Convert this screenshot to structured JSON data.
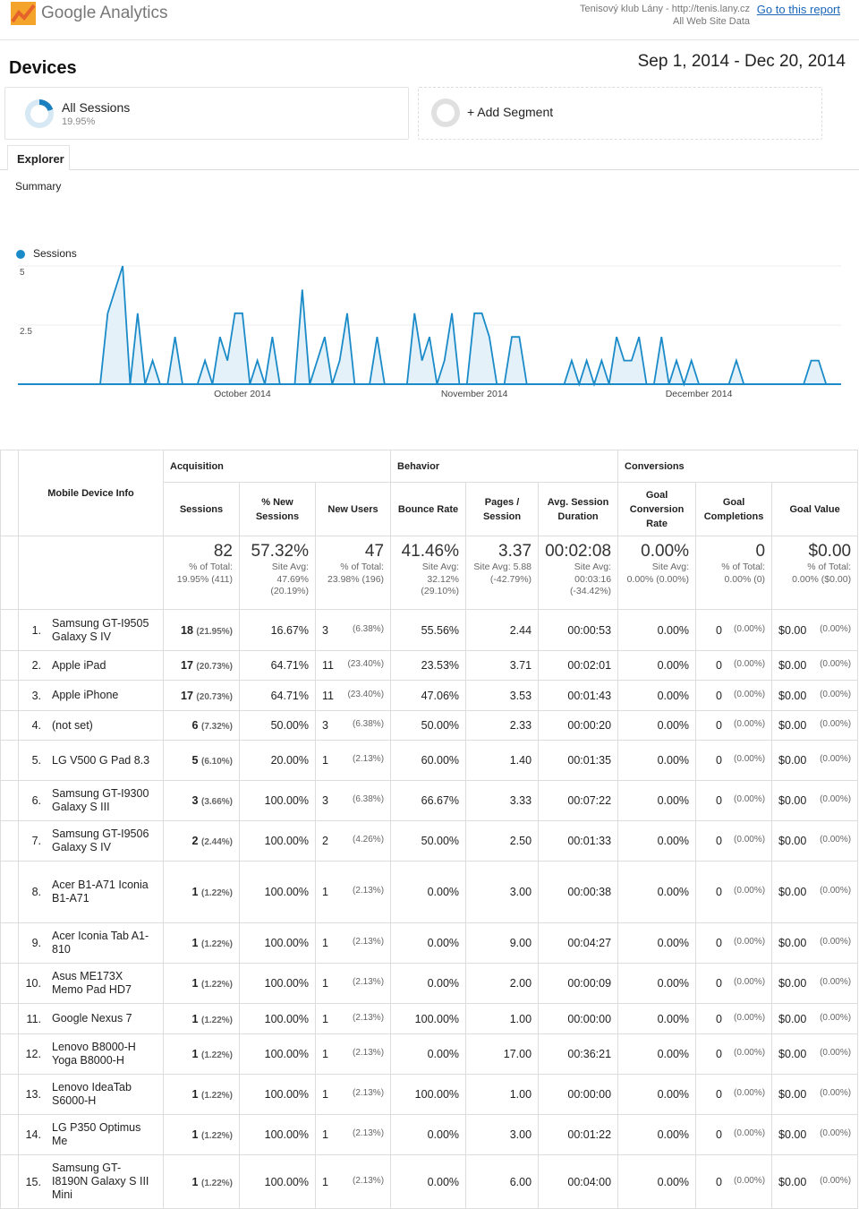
{
  "header": {
    "logo_text": "Google Analytics",
    "property": "Tenisový klub Lány - http://tenis.lany.cz",
    "view": "All Web Site Data",
    "go_to_report": "Go to this report"
  },
  "page": {
    "title": "Devices",
    "date_range": "Sep 1, 2014 - Dec 20, 2014"
  },
  "segments": [
    {
      "label": "All Sessions",
      "percent": "19.95%",
      "fill_fraction": 0.1995
    },
    {
      "label": "+ Add Segment"
    }
  ],
  "tabs": {
    "explorer": "Explorer",
    "summary": "Summary"
  },
  "colors": {
    "series": "#1a8bc8",
    "link": "#1a66b8"
  },
  "chart_data": {
    "type": "area",
    "interval": "day",
    "series": [
      {
        "name": "Sessions",
        "values": [
          0,
          0,
          0,
          0,
          0,
          0,
          0,
          0,
          0,
          0,
          0,
          0,
          3,
          4,
          5,
          0,
          3,
          0,
          1,
          0,
          0,
          2,
          0,
          0,
          0,
          1,
          0,
          2,
          1,
          3,
          3,
          0,
          1,
          0,
          2,
          0,
          0,
          0,
          4,
          0,
          1,
          2,
          0,
          1,
          3,
          0,
          0,
          0,
          2,
          0,
          0,
          0,
          0,
          3,
          1,
          2,
          0,
          1,
          3,
          0,
          0,
          3,
          3,
          2,
          0,
          0,
          2,
          2,
          0,
          0,
          0,
          0,
          0,
          0,
          1,
          0,
          1,
          0,
          1,
          0,
          2,
          1,
          1,
          2,
          0,
          0,
          2,
          0,
          1,
          0,
          1,
          0,
          0,
          0,
          0,
          0,
          1,
          0,
          0,
          0,
          0,
          0,
          0,
          0,
          0,
          0,
          1,
          1,
          0,
          0,
          0
        ]
      }
    ],
    "x_ticks": [
      "October 2014",
      "November 2014",
      "December 2014"
    ],
    "y_ticks": [
      "2.5",
      "5"
    ],
    "ylim": [
      0,
      5
    ],
    "grid": true,
    "legend": "top-left"
  },
  "table": {
    "groups": {
      "dimension": "Mobile Device Info",
      "acquisition": "Acquisition",
      "behavior": "Behavior",
      "conversions": "Conversions"
    },
    "columns": [
      "Sessions",
      "% New Sessions",
      "New Users",
      "Bounce Rate",
      "Pages / Session",
      "Avg. Session Duration",
      "Goal Conversion Rate",
      "Goal Completions",
      "Goal Value"
    ],
    "totals": [
      {
        "value": "82",
        "sub": "% of Total: 19.95% (411)"
      },
      {
        "value": "57.32%",
        "sub": "Site Avg: 47.69% (20.19%)"
      },
      {
        "value": "47",
        "sub": "% of Total: 23.98% (196)"
      },
      {
        "value": "41.46%",
        "sub": "Site Avg: 32.12% (29.10%)"
      },
      {
        "value": "3.37",
        "sub": "Site Avg: 5.88 (-42.79%)"
      },
      {
        "value": "00:02:08",
        "sub": "Site Avg: 00:03:16 (-34.42%)"
      },
      {
        "value": "0.00%",
        "sub": "Site Avg: 0.00% (0.00%)"
      },
      {
        "value": "0",
        "sub": "% of Total: 0.00% (0)"
      },
      {
        "value": "$0.00",
        "sub": "% of Total: 0.00% ($0.00)"
      }
    ],
    "rows": [
      [
        "1.",
        "Samsung GT-I9505 Galaxy S IV",
        "18",
        "(21.95%)",
        "16.67%",
        "3",
        "(6.38%)",
        "55.56%",
        "2.44",
        "00:00:53",
        "0.00%",
        "0",
        "(0.00%)",
        "$0.00",
        "(0.00%)"
      ],
      [
        "2.",
        "Apple iPad",
        "17",
        "(20.73%)",
        "64.71%",
        "11",
        "(23.40%)",
        "23.53%",
        "3.71",
        "00:02:01",
        "0.00%",
        "0",
        "(0.00%)",
        "$0.00",
        "(0.00%)"
      ],
      [
        "3.",
        "Apple iPhone",
        "17",
        "(20.73%)",
        "64.71%",
        "11",
        "(23.40%)",
        "47.06%",
        "3.53",
        "00:01:43",
        "0.00%",
        "0",
        "(0.00%)",
        "$0.00",
        "(0.00%)"
      ],
      [
        "4.",
        "(not set)",
        "6",
        "(7.32%)",
        "50.00%",
        "3",
        "(6.38%)",
        "50.00%",
        "2.33",
        "00:00:20",
        "0.00%",
        "0",
        "(0.00%)",
        "$0.00",
        "(0.00%)"
      ],
      [
        "5.",
        "LG V500 G Pad 8.3",
        "5",
        "(6.10%)",
        "20.00%",
        "1",
        "(2.13%)",
        "60.00%",
        "1.40",
        "00:01:35",
        "0.00%",
        "0",
        "(0.00%)",
        "$0.00",
        "(0.00%)"
      ],
      [
        "6.",
        "Samsung GT-I9300 Galaxy S III",
        "3",
        "(3.66%)",
        "100.00%",
        "3",
        "(6.38%)",
        "66.67%",
        "3.33",
        "00:07:22",
        "0.00%",
        "0",
        "(0.00%)",
        "$0.00",
        "(0.00%)"
      ],
      [
        "7.",
        "Samsung GT-I9506 Galaxy S IV",
        "2",
        "(2.44%)",
        "100.00%",
        "2",
        "(4.26%)",
        "50.00%",
        "2.50",
        "00:01:33",
        "0.00%",
        "0",
        "(0.00%)",
        "$0.00",
        "(0.00%)"
      ],
      [
        "8.",
        "Acer B1-A71 Iconia B1-A71",
        "1",
        "(1.22%)",
        "100.00%",
        "1",
        "(2.13%)",
        "0.00%",
        "3.00",
        "00:00:38",
        "0.00%",
        "0",
        "(0.00%)",
        "$0.00",
        "(0.00%)"
      ],
      [
        "9.",
        "Acer Iconia Tab A1-810",
        "1",
        "(1.22%)",
        "100.00%",
        "1",
        "(2.13%)",
        "0.00%",
        "9.00",
        "00:04:27",
        "0.00%",
        "0",
        "(0.00%)",
        "$0.00",
        "(0.00%)"
      ],
      [
        "10.",
        "Asus ME173X Memo Pad HD7",
        "1",
        "(1.22%)",
        "100.00%",
        "1",
        "(2.13%)",
        "0.00%",
        "2.00",
        "00:00:09",
        "0.00%",
        "0",
        "(0.00%)",
        "$0.00",
        "(0.00%)"
      ],
      [
        "11.",
        "Google Nexus 7",
        "1",
        "(1.22%)",
        "100.00%",
        "1",
        "(2.13%)",
        "100.00%",
        "1.00",
        "00:00:00",
        "0.00%",
        "0",
        "(0.00%)",
        "$0.00",
        "(0.00%)"
      ],
      [
        "12.",
        "Lenovo B8000-H Yoga B8000-H",
        "1",
        "(1.22%)",
        "100.00%",
        "1",
        "(2.13%)",
        "0.00%",
        "17.00",
        "00:36:21",
        "0.00%",
        "0",
        "(0.00%)",
        "$0.00",
        "(0.00%)"
      ],
      [
        "13.",
        "Lenovo IdeaTab S6000-H",
        "1",
        "(1.22%)",
        "100.00%",
        "1",
        "(2.13%)",
        "100.00%",
        "1.00",
        "00:00:00",
        "0.00%",
        "0",
        "(0.00%)",
        "$0.00",
        "(0.00%)"
      ],
      [
        "14.",
        "LG P350 Optimus Me",
        "1",
        "(1.22%)",
        "100.00%",
        "1",
        "(2.13%)",
        "0.00%",
        "3.00",
        "00:01:22",
        "0.00%",
        "0",
        "(0.00%)",
        "$0.00",
        "(0.00%)"
      ],
      [
        "15.",
        "Samsung GT-I8190N Galaxy S III Mini",
        "1",
        "(1.22%)",
        "100.00%",
        "1",
        "(2.13%)",
        "0.00%",
        "6.00",
        "00:04:00",
        "0.00%",
        "0",
        "(0.00%)",
        "$0.00",
        "(0.00%)"
      ]
    ]
  }
}
